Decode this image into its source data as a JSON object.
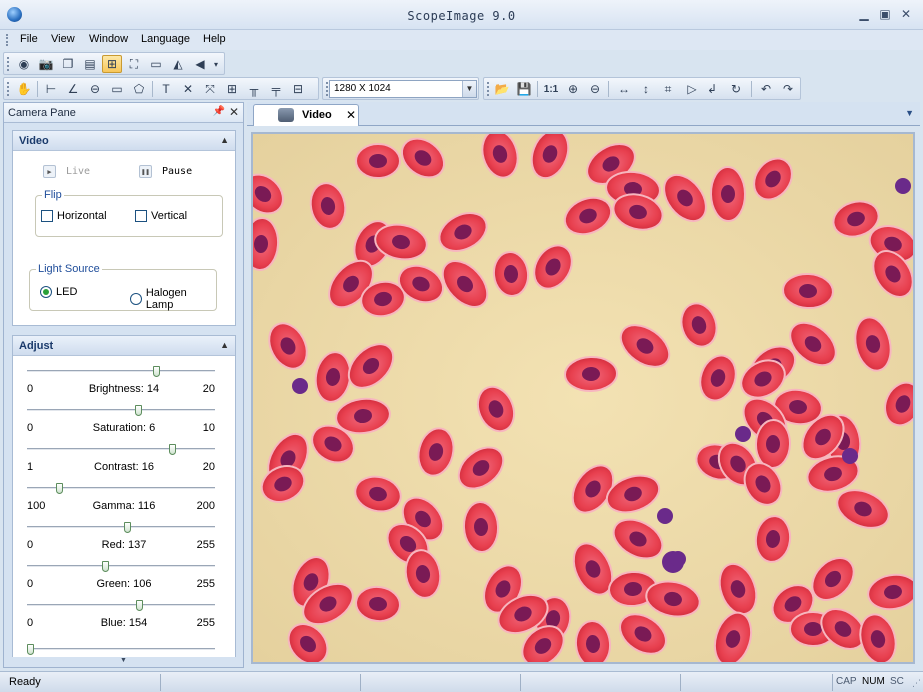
{
  "window": {
    "title": "ScopeImage 9.0"
  },
  "menu": [
    "File",
    "View",
    "Window",
    "Language",
    "Help"
  ],
  "toolbar": {
    "resolution": "1280 X 1024"
  },
  "camera_pane": {
    "title": "Camera Pane",
    "video": {
      "title": "Video",
      "live_label": "Live",
      "pause_label": "Pause",
      "flip": {
        "legend": "Flip",
        "horizontal": "Horizontal",
        "vertical": "Vertical"
      },
      "light": {
        "legend": "Light Source",
        "led": "LED",
        "halogen": "Halogen Lamp",
        "selected": "LED"
      }
    },
    "adjust": {
      "title": "Adjust",
      "sliders": [
        {
          "name": "Brightness",
          "value": 14,
          "min": 0,
          "max": 20
        },
        {
          "name": "Saturation",
          "value": 6,
          "min": 0,
          "max": 10
        },
        {
          "name": "Contrast",
          "value": 16,
          "min": 1,
          "max": 20
        },
        {
          "name": "Gamma",
          "value": 116,
          "min": 100,
          "max": 200
        },
        {
          "name": "Red",
          "value": 137,
          "min": 0,
          "max": 255
        },
        {
          "name": "Green",
          "value": 106,
          "min": 0,
          "max": 255
        },
        {
          "name": "Blue",
          "value": 154,
          "min": 0,
          "max": 255
        }
      ]
    }
  },
  "document_tab": {
    "label": "Video"
  },
  "status": {
    "text": "Ready",
    "cap": "CAP",
    "num": "NUM",
    "scrl": "SC"
  }
}
